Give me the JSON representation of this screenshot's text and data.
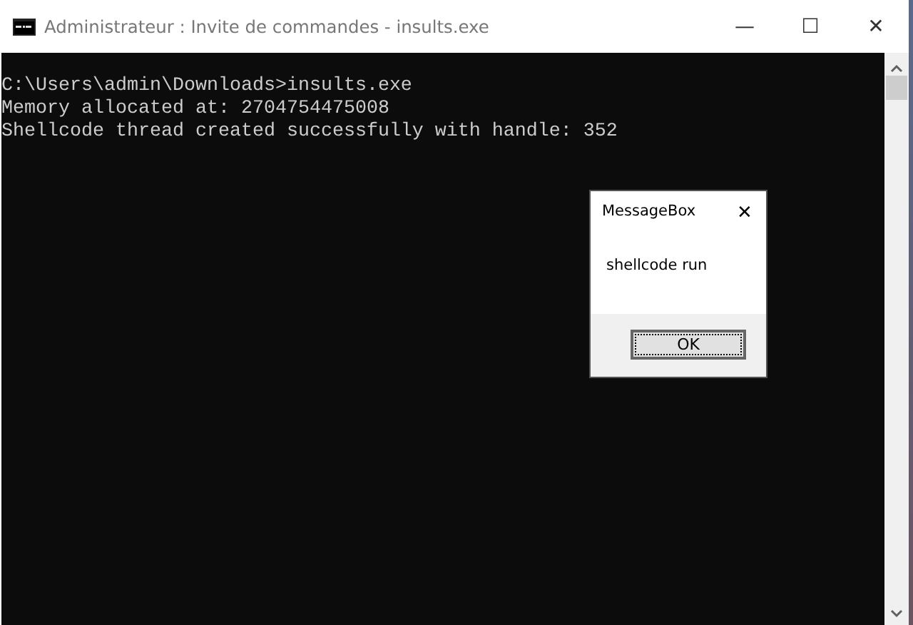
{
  "window": {
    "title": "Administrateur : Invite de commandes - insults.exe",
    "controls": [
      "—",
      "☐",
      "✕"
    ]
  },
  "console": {
    "lines": [
      "C:\\Users\\admin\\Downloads>insults.exe",
      "Memory allocated at: 2704754475008",
      "Shellcode thread created successfully with handle: 352"
    ]
  },
  "message_box": {
    "title": "MessageBox",
    "close": "✕",
    "message": "shellcode run",
    "buttons": [
      {
        "label": "OK",
        "focused": true
      }
    ]
  }
}
